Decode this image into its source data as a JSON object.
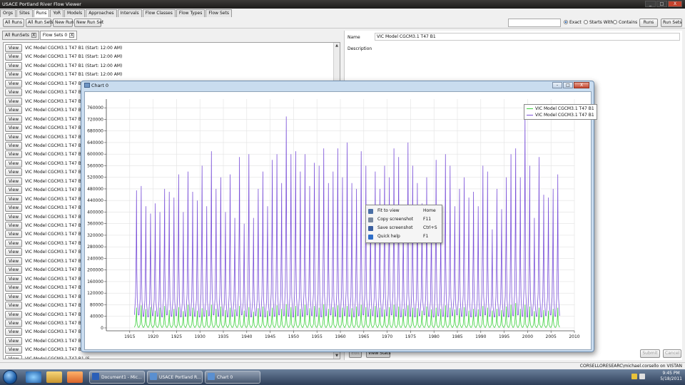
{
  "app": {
    "title": "USACE Portland River Flow Viewer",
    "window_buttons": [
      "_",
      "□",
      "X"
    ]
  },
  "nav_tabs": [
    "Orgs",
    "Sites",
    "Runs",
    "YoR",
    "Models",
    "Approaches",
    "Intervals",
    "Flow Classes",
    "Flow Types",
    "Flow Sets"
  ],
  "active_tab": "Runs",
  "toolbar": {
    "all_runs": "All Runs",
    "all_run_sets": "All Run Sets",
    "new_run": "New Run",
    "new_run_set": "New Run Set",
    "search_value": "",
    "match_options": [
      "Exact",
      "Starts With",
      "Contains"
    ],
    "match_selected": "Exact",
    "runs_button": "Runs",
    "run_sets_button": "Run Sets"
  },
  "left_tabs": [
    {
      "label": "All RunSets",
      "close": "X"
    },
    {
      "label": "Flow Sets 0",
      "close": "X"
    }
  ],
  "flow_list": {
    "view_label": "View",
    "rows": [
      "VIC Model CGCM3.1 T47 B1 (Start: 12:00 AM)",
      "VIC Model CGCM3.1 T47 B1 (Start: 12:00 AM)",
      "VIC Model CGCM3.1 T47 B1 (Start: 12:00 AM)",
      "VIC Model CGCM3.1 T47 B1 (Start: 12:00 AM)",
      "VIC Model CGCM3.1 T47 B1 (S",
      "VIC Model CGCM3.1 T47 B1 (S",
      "VIC Model CGCM3.1 T47 B1 (S",
      "VIC Model CGCM3.1 T47 B1 (S",
      "VIC Model CGCM3.1 T47 B1 (S",
      "VIC Model CGCM3.1 T47 B1 (S",
      "VIC Model CGCM3.1 T47 B1 (S",
      "VIC Model CGCM3.1 T47 B1 (S",
      "VIC Model CGCM3.1 T47 B1 (S",
      "VIC Model CGCM3.1 T47 B1 (S",
      "VIC Model CGCM3.1 T47 B1 (S",
      "VIC Model CGCM3.1 T47 B1 (S",
      "VIC Model CGCM3.1 T47 B1 (S",
      "VIC Model CGCM3.1 T47 B1 (S",
      "VIC Model CGCM3.1 T47 B1 (S",
      "VIC Model CGCM3.1 T47 B1 (S",
      "VIC Model CGCM3.1 T47 B1 (S",
      "VIC Model CGCM3.1 T47 B1 (S",
      "VIC Model CGCM3.1 T47 B1 (S",
      "VIC Model CGCM3.1 T47 B1 (S",
      "VIC Model CGCM3.1 T47 B1 (S",
      "VIC Model CGCM3.1 T47 B1 (S",
      "VIC Model CGCM3.1 T47 B1 (S",
      "VIC Model CGCM3.1 T47 B1 (S",
      "VIC Model CGCM3.1 T47 B1 (S",
      "VIC Model CGCM3.1 T47 B1 (S",
      "VIC Model CGCM3.1 T47 B1 (S",
      "VIC Model CGCM3.1 T47 B1 (S",
      "VIC Model CGCM3.1 T47 B1 (S",
      "VIC Model CGCM3.1 T47 B1 (S",
      "VIC Model CGCM3.1 T47 B1 (S",
      "VIC Model CGCM3.1 T47 B1 (S",
      "VIC Model CGCM3.1 T47 B1 (Start: 12:00 AM)"
    ]
  },
  "details": {
    "name_label": "Name",
    "name_value": "VIC Model CGCM3.1 T47 B1",
    "description_label": "Description",
    "description_value": "",
    "edit_button": "Edit",
    "view_stats_button": "View Stats",
    "submit_button": "Submit",
    "cancel_button": "Cancel"
  },
  "status_bar": "CORSELLORESEARC\\michael.corsello on VISTAN",
  "chart_window": {
    "title": "Chart 0",
    "buttons": [
      "-",
      "□",
      "X"
    ],
    "context_menu": [
      {
        "label": "Fit to view",
        "shortcut": "Home",
        "icon": "fit-icon",
        "color": "#4a6fa5"
      },
      {
        "label": "Copy screenshot",
        "shortcut": "F11",
        "icon": "copy-icon",
        "color": "#7a8aa0"
      },
      {
        "label": "Save screenshot",
        "shortcut": "Ctrl+S",
        "icon": "save-icon",
        "color": "#3a5fa0"
      },
      {
        "label": "Quick help",
        "shortcut": "F1",
        "icon": "help-icon",
        "color": "#2f6fc9"
      }
    ]
  },
  "chart_data": {
    "type": "line",
    "title": "",
    "xlabel": "",
    "ylabel": "",
    "xlim": [
      1910,
      2010
    ],
    "ylim": [
      -10000,
      790000
    ],
    "x_ticks": [
      1915,
      1920,
      1925,
      1930,
      1935,
      1940,
      1945,
      1950,
      1955,
      1960,
      1965,
      1970,
      1975,
      1980,
      1985,
      1990,
      1995,
      2000,
      2005,
      2010
    ],
    "y_ticks": [
      0,
      40000,
      80000,
      120000,
      160000,
      200000,
      240000,
      280000,
      320000,
      360000,
      400000,
      440000,
      480000,
      520000,
      560000,
      600000,
      640000,
      680000,
      720000,
      760000
    ],
    "y_tick_labels": [
      "0",
      "40000",
      "80000",
      "120000",
      "160000",
      "200000",
      "240000",
      "280000",
      "320000",
      "360000",
      "400000",
      "440000",
      "480000",
      "520000",
      "560000",
      "600000",
      "640000",
      "680000",
      "720000",
      "760000"
    ],
    "grid": true,
    "legend_position": "top-right",
    "series": [
      {
        "name": "VIC Model CGCM3.1 T47 B1",
        "color": "#3fd13f",
        "annual_cycle": true,
        "years": [
          1916,
          1917,
          1918,
          1919,
          1920,
          1921,
          1922,
          1923,
          1924,
          1925,
          1926,
          1927,
          1928,
          1929,
          1930,
          1931,
          1932,
          1933,
          1934,
          1935,
          1936,
          1937,
          1938,
          1939,
          1940,
          1941,
          1942,
          1943,
          1944,
          1945,
          1946,
          1947,
          1948,
          1949,
          1950,
          1951,
          1952,
          1953,
          1954,
          1955,
          1956,
          1957,
          1958,
          1959,
          1960,
          1961,
          1962,
          1963,
          1964,
          1965,
          1966,
          1967,
          1968,
          1969,
          1970,
          1971,
          1972,
          1973,
          1974,
          1975,
          1976,
          1977,
          1978,
          1979,
          1980,
          1981,
          1982,
          1983,
          1984,
          1985,
          1986,
          1987,
          1988,
          1989,
          1990,
          1991,
          1992,
          1993,
          1994,
          1995,
          1996,
          1997,
          1998,
          1999,
          2000,
          2001,
          2002,
          2003,
          2004,
          2005,
          2006
        ],
        "peaks": [
          70000,
          78000,
          65000,
          72000,
          60000,
          70000,
          76000,
          62000,
          66000,
          72000,
          58000,
          80000,
          70000,
          60000,
          68000,
          62000,
          80000,
          66000,
          74000,
          62000,
          70000,
          64000,
          76000,
          60000,
          72000,
          56000,
          68000,
          74000,
          60000,
          70000,
          78000,
          66000,
          82000,
          72000,
          76000,
          66000,
          80000,
          68000,
          76000,
          70000,
          82000,
          66000,
          72000,
          78000,
          70000,
          76000,
          68000,
          74000,
          80000,
          72000,
          66000,
          76000,
          70000,
          64000,
          72000,
          80000,
          74000,
          66000,
          78000,
          70000,
          68000,
          60000,
          74000,
          64000,
          70000,
          66000,
          78000,
          70000,
          64000,
          68000,
          72000,
          60000,
          66000,
          64000,
          76000,
          70000,
          60000,
          66000,
          62000,
          74000,
          80000,
          86000,
          66000,
          80000,
          74000,
          58000,
          70000,
          62000,
          60000,
          66000,
          70000
        ],
        "troughs": [
          2000,
          2000,
          2000,
          2000,
          2000,
          2000,
          2000,
          2000,
          2000,
          2000,
          2000,
          2000,
          2000,
          2000,
          2000,
          2000,
          2000,
          2000,
          2000,
          2000,
          2000,
          2000,
          2000,
          2000,
          2000,
          2000,
          2000,
          2000,
          2000,
          2000,
          2000,
          2000,
          2000,
          2000,
          2000,
          2000,
          2000,
          2000,
          2000,
          2000,
          2000,
          2000,
          2000,
          2000,
          2000,
          2000,
          2000,
          2000,
          2000,
          2000,
          2000,
          2000,
          2000,
          2000,
          2000,
          2000,
          2000,
          2000,
          2000,
          2000,
          2000,
          2000,
          2000,
          2000,
          2000,
          2000,
          2000,
          2000,
          2000,
          2000,
          2000,
          2000,
          2000,
          2000,
          2000,
          2000,
          2000,
          2000,
          2000,
          2000,
          2000,
          2000,
          2000,
          2000,
          2000,
          2000,
          2000,
          2000,
          2000,
          2000,
          2000
        ]
      },
      {
        "name": "VIC Model CGCM3.1 T47 B1",
        "color": "#7a50d8",
        "annual_cycle": true,
        "years": [
          1916,
          1917,
          1918,
          1919,
          1920,
          1921,
          1922,
          1923,
          1924,
          1925,
          1926,
          1927,
          1928,
          1929,
          1930,
          1931,
          1932,
          1933,
          1934,
          1935,
          1936,
          1937,
          1938,
          1939,
          1940,
          1941,
          1942,
          1943,
          1944,
          1945,
          1946,
          1947,
          1948,
          1949,
          1950,
          1951,
          1952,
          1953,
          1954,
          1955,
          1956,
          1957,
          1958,
          1959,
          1960,
          1961,
          1962,
          1963,
          1964,
          1965,
          1966,
          1967,
          1968,
          1969,
          1970,
          1971,
          1972,
          1973,
          1974,
          1975,
          1976,
          1977,
          1978,
          1979,
          1980,
          1981,
          1982,
          1983,
          1984,
          1985,
          1986,
          1987,
          1988,
          1989,
          1990,
          1991,
          1992,
          1993,
          1994,
          1995,
          1996,
          1997,
          1998,
          1999,
          2000,
          2001,
          2002,
          2003,
          2004,
          2005,
          2006
        ],
        "peaks": [
          475000,
          490000,
          420000,
          395000,
          430000,
          400000,
          480000,
          470000,
          450000,
          530000,
          400000,
          540000,
          470000,
          440000,
          560000,
          420000,
          610000,
          480000,
          520000,
          400000,
          530000,
          380000,
          590000,
          360000,
          600000,
          380000,
          480000,
          540000,
          420000,
          580000,
          600000,
          500000,
          730000,
          600000,
          610000,
          540000,
          600000,
          490000,
          570000,
          560000,
          620000,
          500000,
          540000,
          620000,
          520000,
          640000,
          500000,
          480000,
          610000,
          560000,
          420000,
          540000,
          480000,
          560000,
          520000,
          620000,
          590000,
          420000,
          640000,
          560000,
          500000,
          430000,
          520000,
          400000,
          580000,
          380000,
          600000,
          560000,
          420000,
          480000,
          520000,
          450000,
          470000,
          420000,
          560000,
          540000,
          340000,
          480000,
          410000,
          520000,
          600000,
          620000,
          520000,
          740000,
          560000,
          380000,
          590000,
          460000,
          450000,
          480000,
          530000
        ],
        "troughs": [
          45000,
          40000,
          38000,
          42000,
          40000,
          38000,
          45000,
          40000,
          42000,
          38000,
          40000,
          42000,
          40000,
          38000,
          40000,
          42000,
          45000,
          40000,
          42000,
          38000,
          40000,
          42000,
          45000,
          40000,
          38000,
          42000,
          40000,
          38000,
          42000,
          40000,
          45000,
          42000,
          40000,
          38000,
          42000,
          40000,
          45000,
          42000,
          40000,
          38000,
          42000,
          45000,
          40000,
          38000,
          42000,
          40000,
          38000,
          42000,
          45000,
          40000,
          42000,
          38000,
          40000,
          42000,
          45000,
          40000,
          38000,
          42000,
          40000,
          38000,
          42000,
          45000,
          40000,
          38000,
          42000,
          40000,
          38000,
          42000,
          45000,
          40000,
          42000,
          38000,
          40000,
          42000,
          45000,
          40000,
          38000,
          42000,
          40000,
          38000,
          42000,
          45000,
          40000,
          38000,
          42000,
          40000,
          38000,
          42000,
          45000,
          40000,
          42000
        ]
      }
    ]
  },
  "taskbar": {
    "items": [
      "Document1 - Mic...",
      "USACE Portland R...",
      "Chart 0"
    ],
    "time": "9:45 PM",
    "date": "5/18/2011"
  }
}
